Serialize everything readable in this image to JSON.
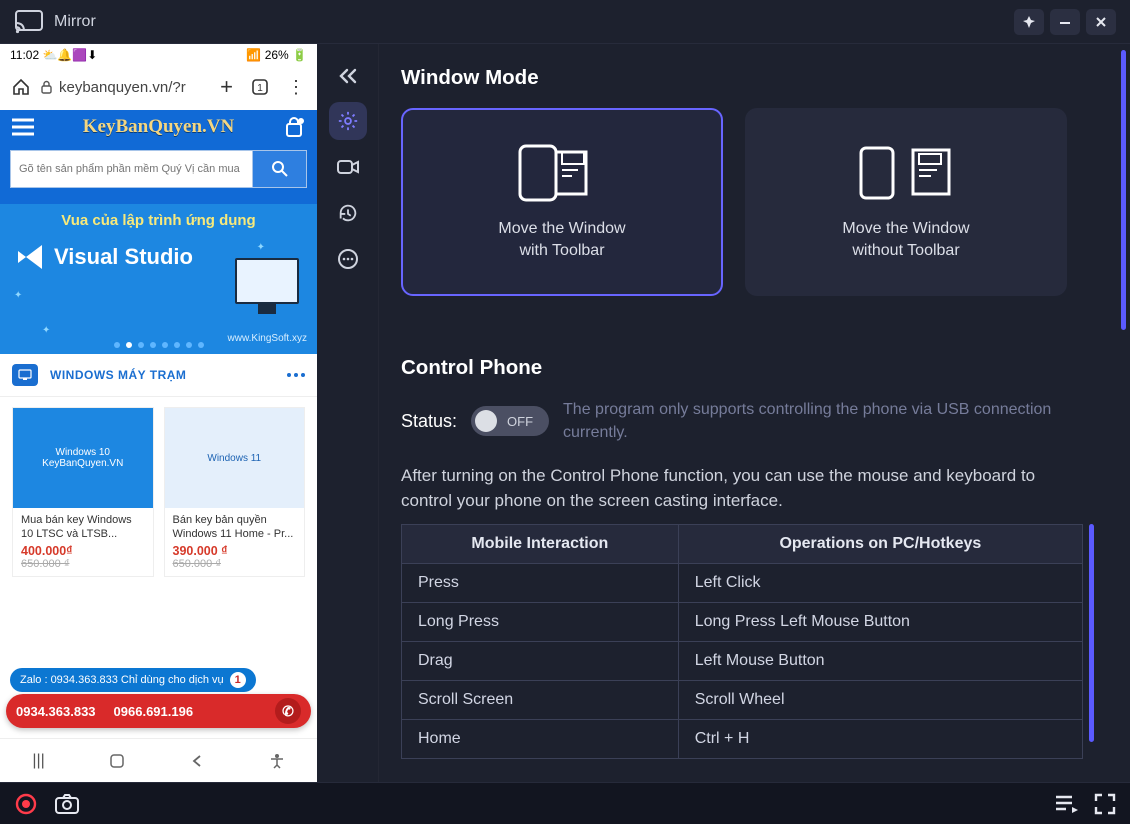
{
  "app": {
    "title": "Mirror"
  },
  "phone": {
    "clock": "11:02",
    "battery_text": "26%",
    "url": "keybanquyen.vn/?r",
    "site_title": "KeyBanQuyen.VN",
    "search_placeholder": "Gõ tên sản phẩm phần mềm Quý Vị cần mua",
    "banner_tagline": "Vua của lập trình ứng dụng",
    "banner_brand": "Visual Studio",
    "banner_url": "www.KingSoft.xyz",
    "category_label": "WINDOWS MÁY TRẠM",
    "products": [
      {
        "img_text": "Windows 10\nKeyBanQuyen.VN",
        "title": "Mua bán key Windows 10 LTSC và LTSB...",
        "price": "400.000₫",
        "old": "650.000 ₫"
      },
      {
        "img_text": "Windows 11",
        "title": "Bán key bản quyền Windows 11 Home - Pr...",
        "price": "390.000 ₫",
        "old": "650.000 ₫"
      }
    ],
    "zalo_text": "Zalo : 0934.363.833 Chỉ dùng cho dịch vụ",
    "zalo_badge": "1",
    "phone_a": "0934.363.833",
    "phone_b": "0966.691.196"
  },
  "settings": {
    "window_mode_heading": "Window Mode",
    "wm_with_l1": "Move the Window",
    "wm_with_l2": "with Toolbar",
    "wm_without_l1": "Move the Window",
    "wm_without_l2": "without Toolbar",
    "control_heading": "Control Phone",
    "status_label": "Status:",
    "switch_off": "OFF",
    "status_hint": "The program only supports controlling the phone via USB connection currently.",
    "control_note": "After turning on the Control Phone function, you can use the mouse and keyboard to control your phone on the screen casting interface.",
    "th_mobile": "Mobile Interaction",
    "th_pc": "Operations on PC/Hotkeys",
    "rows": [
      {
        "m": "Press",
        "p": "Left Click"
      },
      {
        "m": "Long Press",
        "p": "Long Press Left Mouse Button"
      },
      {
        "m": "Drag",
        "p": "Left Mouse Button"
      },
      {
        "m": "Scroll Screen",
        "p": "Scroll Wheel"
      },
      {
        "m": "Home",
        "p": "Ctrl + H"
      }
    ]
  }
}
